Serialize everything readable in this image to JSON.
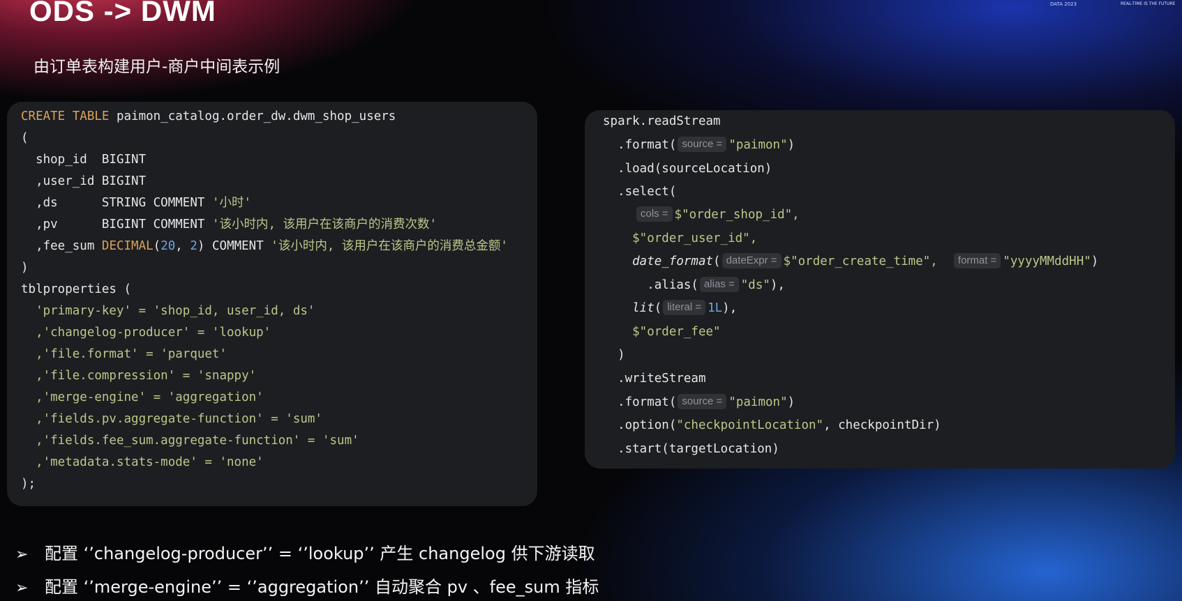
{
  "slide": {
    "title": "ODS -> DWM",
    "subtitle": "由订单表构建用户-商户中间表示例",
    "event_logo": "DATA 2023",
    "event_tagline": "REAL-TIME IS THE FUTURE"
  },
  "sql_code": {
    "line1_kw": "CREATE TABLE",
    "line1_name": " paimon_catalog.order_dw.dwm_shop_users",
    "line2": "(",
    "line3": "  shop_id  BIGINT",
    "line4": "  ,user_id BIGINT",
    "line5_a": "  ,ds      STRING COMMENT ",
    "line5_str": "'小时'",
    "line6_a": "  ,pv      BIGINT COMMENT ",
    "line6_str": "'该小时内, 该用户在该商户的消费次数'",
    "line7_a": "  ,fee_sum ",
    "line7_kw": "DECIMAL",
    "line7_b": "(",
    "line7_num1": "20",
    "line7_c": ", ",
    "line7_num2": "2",
    "line7_d": ") COMMENT ",
    "line7_str": "'该小时内, 该用户在该商户的消费总金额'",
    "line8": ")",
    "line9": "tblproperties (",
    "line10": "  'primary-key' = 'shop_id, user_id, ds'",
    "line11": "  ,'changelog-producer' = 'lookup'",
    "line12": "  ,'file.format' = 'parquet'",
    "line13": "  ,'file.compression' = 'snappy'",
    "line14": "  ,'merge-engine' = 'aggregation'",
    "line15": "  ,'fields.pv.aggregate-function' = 'sum'",
    "line16": "  ,'fields.fee_sum.aggregate-function' = 'sum'",
    "line17": "  ,'metadata.stats-mode' = 'none'",
    "line18": ");"
  },
  "spark_code": {
    "l1": "spark.readStream",
    "l2_a": "  .format(",
    "l2_hint": "source =",
    "l2_str": "\"paimon\"",
    "l2_b": ")",
    "l3": "  .load(sourceLocation)",
    "l4": "  .select(",
    "l5_hint": "cols =",
    "l5_str": "$\"order_shop_id\",",
    "l6_str": "    $\"order_user_id\",",
    "l7_fn": "    date_format",
    "l7_a": "(",
    "l7_hint1": "dateExpr =",
    "l7_str1": "$\"order_create_time\",",
    "l7_hint2": "format =",
    "l7_str2": "\"yyyyMMddHH\"",
    "l7_b": ")",
    "l8_a": "      .alias(",
    "l8_hint": "alias =",
    "l8_str": "\"ds\"",
    "l8_b": "),",
    "l9_fn": "    lit",
    "l9_a": "(",
    "l9_hint": "literal =",
    "l9_num": "1L",
    "l9_b": "),",
    "l10_str": "    $\"order_fee\"",
    "l11": "  )",
    "l12": "  .writeStream",
    "l13_a": "  .format(",
    "l13_hint": "source =",
    "l13_str": "\"paimon\"",
    "l13_b": ")",
    "l14_a": "  .option(",
    "l14_str": "\"checkpointLocation\"",
    "l14_b": ", checkpointDir)",
    "l15": "  .start(targetLocation)"
  },
  "bullets": [
    {
      "arrow": "➢",
      "text": "配置 ‘’changelog-producer’’ =  ‘’lookup’’ 产生 changelog 供下游读取"
    },
    {
      "arrow": "➢",
      "text": "配置 ‘’merge-engine’’ = ‘’aggregation’’ 自动聚合 pv 、fee_sum 指标"
    }
  ]
}
